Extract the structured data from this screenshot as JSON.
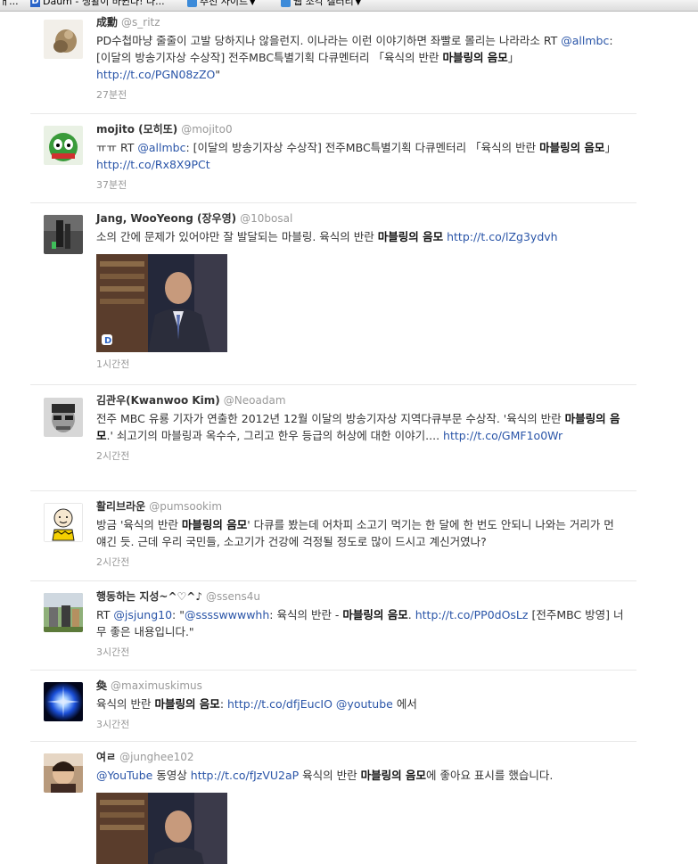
{
  "toolbar": {
    "left_fragment": "ㅐ...",
    "daum_label": "Daum - 생활이 바뀐다! 나...",
    "recommended_sites": "추천 사이트",
    "web_slice_gallery": "웹 조각 갤러리"
  },
  "colors": {
    "link": "#2a55a8",
    "name": "#333333",
    "meta": "#999999"
  },
  "tweets": [
    {
      "name": "成勳",
      "handle": "@s_ritz",
      "text_prefix": "PD수첩마냥 줄줄이 고발 당하지나 않을런지. 이나라는 이런 이야기하면 좌빨로 몰리는 나라라소 RT ",
      "mention": "@allmbc",
      "text_mid": ": [이달의 방송기자상 수상작] 전주MBC특별기획 다큐멘터리 「육식의 반란 ",
      "bold": "마블링의 음모",
      "text_after": "」 ",
      "url": "http://t.co/PGN08zZO",
      "text_end": "\"",
      "time": "27분전"
    },
    {
      "name": "mojito (모히또)",
      "handle": "@mojito0",
      "text_prefix": "ㅠㅠ RT ",
      "mention": "@allmbc",
      "text_mid": ": [이달의 방송기자상 수상작] 전주MBC특별기획 다큐멘터리 「육식의 반란 ",
      "bold": "마블링의 음모",
      "text_after": "」 ",
      "url": "http://t.co/Rx8X9PCt",
      "time": "37분전"
    },
    {
      "name": "Jang, WooYeong (장우영)",
      "handle": "@10bosal",
      "text_prefix": "소의 간에 문제가 있어야만 잘 발달되는 마블링. 육식의 반란 ",
      "bold": "마블링의 음모",
      "text_after": " ",
      "url": "http://t.co/lZg3ydvh",
      "media_play": "D",
      "time": "1시간전"
    },
    {
      "name": "김관우(Kwanwoo Kim)",
      "handle": "@Neoadam",
      "text_prefix": "전주 MBC 유룡 기자가 연출한 2012년 12월 이달의 방송기자상 지역다큐부문 수상작. '육식의 반란 ",
      "bold": "마블링의 음모",
      "text_after": ".' 쇠고기의 마블링과 옥수수, 그리고 한우 등급의 허상에 대한 이야기.... ",
      "url": "http://t.co/GMF1o0Wr",
      "time": "2시간전"
    },
    {
      "name": "활리브라운",
      "handle": "@pumsookim",
      "text_prefix": "방금 '육식의 반란 ",
      "bold": "마블링의 음모",
      "text_after": "' 다큐를 봤는데 어차피 소고기 먹기는 한 달에 한 번도 안되니 나와는 거리가 먼 얘긴 듯. 근데 우리 국민들, 소고기가 건강에 걱정될 정도로 많이 드시고 계신거였나?",
      "time": "2시간전"
    },
    {
      "name": "행동하는 지성~^♡^♪",
      "handle": "@ssens4u",
      "text_prefix": "RT ",
      "mention": "@jsjung10",
      "text_mid": ": \"",
      "mention2": "@sssswwwwhh",
      "text_mid2": ": 육식의 반란 - ",
      "bold": "마블링의 음모",
      "text_after": ". ",
      "url": "http://t.co/PP0dOsLz",
      "text_end": " [전주MBC 방영] 너무 좋은 내용입니다.\"",
      "time": "3시간전"
    },
    {
      "name": "奐",
      "handle": "@maximuskimus",
      "text_prefix": "육식의 반란 ",
      "bold": "마블링의 음모",
      "text_after": ": ",
      "url": "http://t.co/dfjEucIO",
      "mention_after_url": "@youtube",
      "text_end": " 에서",
      "time": "3시간전"
    },
    {
      "name": "여ㄹ",
      "handle": "@junghee102",
      "mention": "@YouTube",
      "text_mid": " 동영상 ",
      "url_mid": "http://t.co/fJzVU2aP",
      "text_mid2": " 육식의 반란 ",
      "bold": "마블링의 음모",
      "text_end": "에 좋아요 표시를 했습니다."
    }
  ]
}
